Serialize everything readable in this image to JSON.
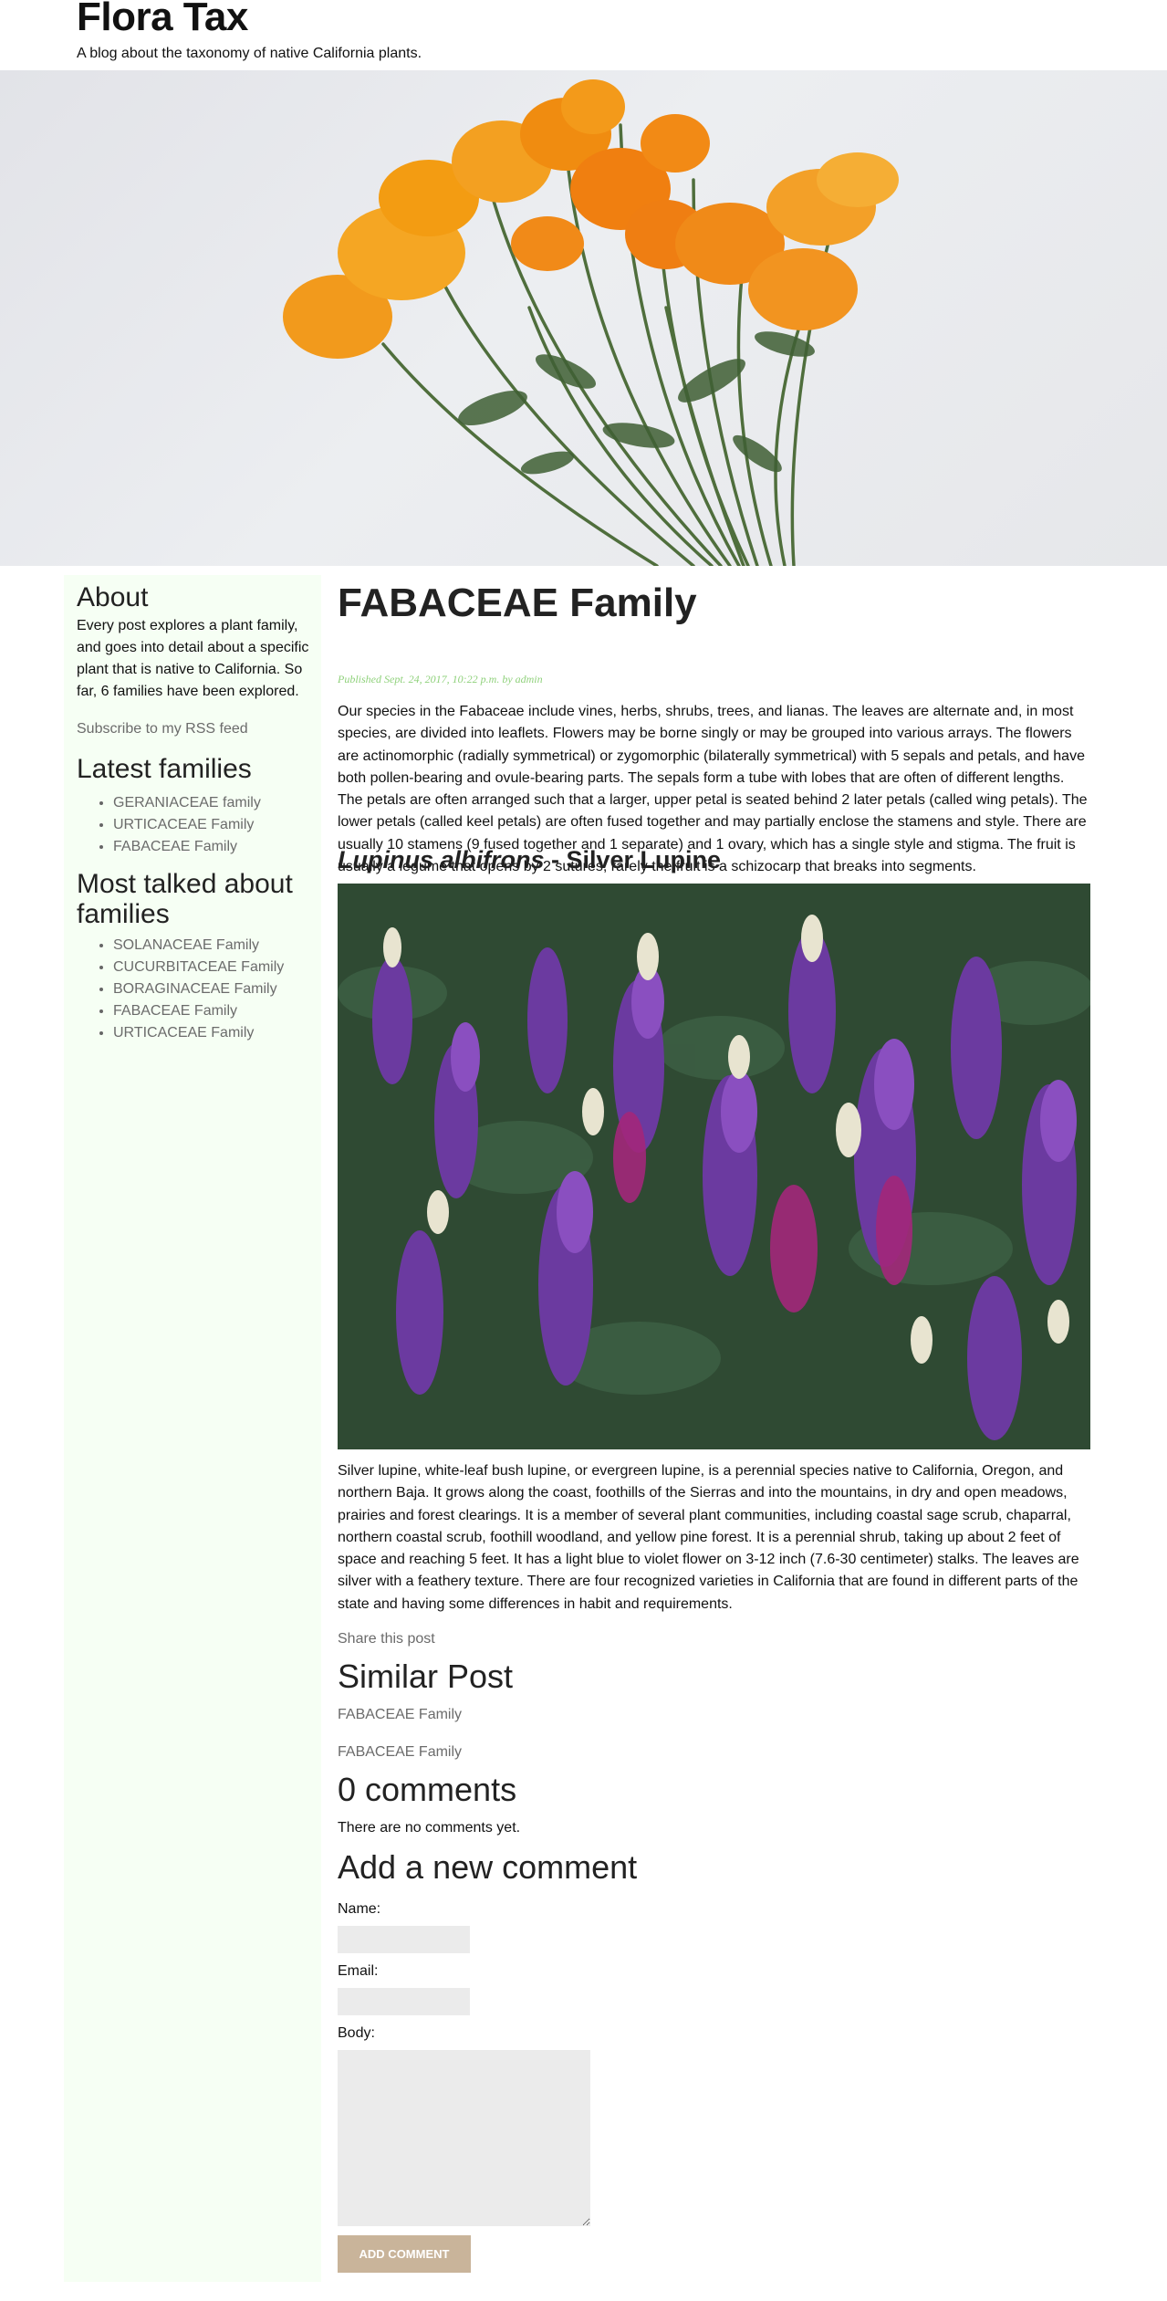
{
  "site": {
    "title": "Flora Tax",
    "tagline": "A blog about the taxonomy of native California plants."
  },
  "hero": {
    "alt": "Orange California poppies on a white background"
  },
  "sidebar": {
    "about_heading": "About",
    "about_text": "Every post explores a plant family, and goes into detail about a specific plant that is native to California. So far, 6 families have been explored.",
    "rss_link": "Subscribe to my RSS feed",
    "latest_heading": "Latest families",
    "latest": [
      "GERANIACEAE family",
      "URTICACEAE Family",
      "FABACEAE Family"
    ],
    "most_talked_heading_line1": "Most talked about",
    "most_talked_heading_line2": "families",
    "most_talked": [
      "SOLANACEAE Family",
      "CUCURBITACEAE Family",
      "BORAGINACEAE Family",
      "FABACEAE Family",
      "URTICACEAE Family"
    ]
  },
  "post": {
    "title": "FABACEAE Family",
    "meta": "Published Sept. 24, 2017, 10:22 p.m. by admin",
    "intro": "Our species in the Fabaceae include vines, herbs, shrubs, trees, and lianas. The leaves are alternate and, in most species, are divided into leaflets. Flowers may be borne singly or may be grouped into various arrays. The flowers are actinomorphic (radially symmetrical) or zygomorphic (bilaterally symmetrical) with 5 sepals and petals, and have both pollen-bearing and ovule-bearing parts. The sepals form a tube with lobes that are often of different lengths. The petals are often arranged such that a larger, upper petal is seated behind 2 later petals (called wing petals). The lower petals (called keel petals) are often fused together and may partially enclose the stamens and style. There are usually 10 stamens (9 fused together and 1 separate) and 1 ovary, which has a single style and stigma. The fruit is usually a legume that opens by 2 sutures; rarely the fruit is a schizocarp that breaks into segments.",
    "species_latin": "Lupinus albifrons",
    "species_common": " - Silver Lupine",
    "species_text": "Silver lupine, white-leaf bush lupine, or evergreen lupine, is a perennial species native to California, Oregon, and northern Baja. It grows along the coast, foothills of the Sierras and into the mountains, in dry and open meadows, prairies and forest clearings. It is a member of several plant communities, including coastal sage scrub, chaparral, northern coastal scrub, foothill woodland, and yellow pine forest. It is a perennial shrub, taking up about 2 feet of space and reaching 5 feet. It has a light blue to violet flower on 3-12 inch (7.6-30 centimeter) stalks. The leaves are silver with a feathery texture. There are four recognized varieties in California that are found in different parts of the state and having some differences in habit and requirements.",
    "share": "Share this post"
  },
  "similar": {
    "heading": "Similar Post",
    "links": [
      "FABACEAE Family",
      "FABACEAE Family"
    ]
  },
  "comments": {
    "heading": "0 comments",
    "empty": "There are no comments yet."
  },
  "form": {
    "heading": "Add a new comment",
    "name_label": "Name:",
    "email_label": "Email:",
    "body_label": "Body:",
    "submit": "ADD COMMENT"
  },
  "colors": {
    "sidebar_bg": "#f6fff4",
    "meta": "#8fd17b",
    "link": "#6b6b6b",
    "button": "#c9b49a"
  }
}
